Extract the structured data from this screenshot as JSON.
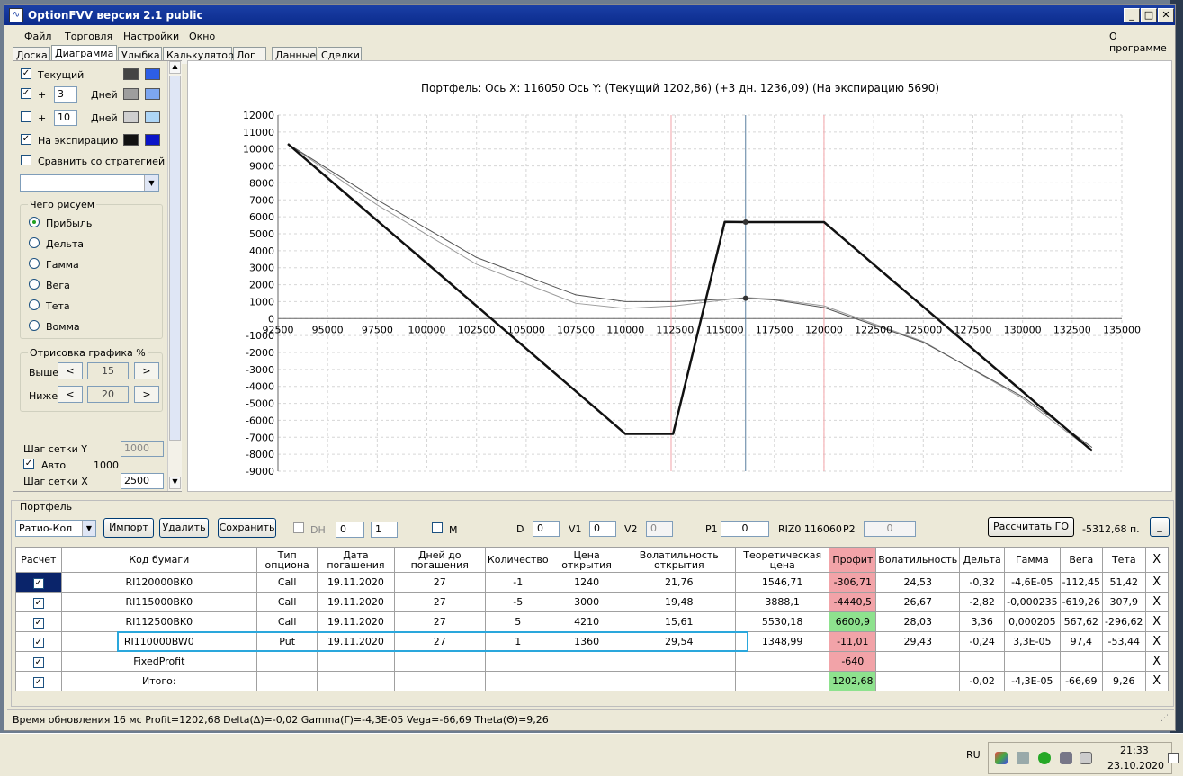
{
  "window": {
    "title": "OptionFVV версия 2.1 public"
  },
  "menu": {
    "items": [
      "Файл",
      "Торговля",
      "Настройки",
      "Окно"
    ],
    "about": "О программе"
  },
  "tabs": [
    "Доска",
    "Диаграмма",
    "Улыбка",
    "Калькулятор",
    "Лог",
    "Данные",
    "Сделки"
  ],
  "left": {
    "current_label": "Текущий",
    "plus": "+",
    "days_label": "Дней",
    "days1": "3",
    "days2": "10",
    "expiry_label": "На экспирацию",
    "compare_label": "Сравнить со стратегией",
    "draw_group": "Чего рисуем",
    "radios": [
      "Прибыль",
      "Дельта",
      "Гамма",
      "Вега",
      "Тета",
      "Вомма"
    ],
    "render_group": "Отрисовка графика %",
    "above_label": "Выше",
    "below_label": "Ниже",
    "above_val": "15",
    "below_val": "20",
    "grid_y_label": "Шаг сетки Y",
    "grid_y_val": "1000",
    "auto_label": "Авто",
    "auto_val": "1000",
    "grid_x_label": "Шаг сетки X",
    "grid_x_val": "2500",
    "arrow_left": "<",
    "arrow_right": ">",
    "colors": {
      "current": [
        "#444444",
        "#2d5ee6"
      ],
      "plus3": [
        "#9e9e9e",
        "#7da6f0"
      ],
      "plus10": [
        "#cfcfcf",
        "#aed6f6"
      ],
      "expiry": [
        "#111111",
        "#0a14c8"
      ]
    }
  },
  "chart_data": {
    "type": "line",
    "title": "Портфель: Ось X: 116050 Ось Y:  (Текущий 1202,86)  (+3 дн. 1236,09)  (На экспирацию 5690)",
    "xlim": [
      92500,
      135000
    ],
    "ylim": [
      -9000,
      12000
    ],
    "x_ticks": [
      92500,
      95000,
      97500,
      100000,
      102500,
      105000,
      107500,
      110000,
      112500,
      115000,
      117500,
      120000,
      122500,
      125000,
      127500,
      130000,
      132500,
      135000
    ],
    "y_ticks": [
      12000,
      11000,
      10000,
      9000,
      8000,
      7000,
      6000,
      5000,
      4000,
      3000,
      2000,
      1000,
      0,
      -1000,
      -2000,
      -3000,
      -4000,
      -5000,
      -6000,
      -7000,
      -8000,
      -9000
    ],
    "grid": true,
    "vlines": [
      {
        "x": 112300,
        "color": "#f2a3a8"
      },
      {
        "x": 116050,
        "color": "#5a7fa0"
      },
      {
        "x": 120000,
        "color": "#f2a3a8"
      }
    ],
    "series": [
      {
        "color": "#111111",
        "width": 2.5,
        "x": [
          93000,
          110000,
          112400,
          115000,
          116050,
          120000,
          133500
        ],
        "y": [
          10300,
          -6800,
          -6800,
          5700,
          5690,
          5690,
          -7800
        ]
      },
      {
        "color": "#555555",
        "width": 1,
        "x": [
          93000,
          97500,
          102500,
          107500,
          110000,
          112500,
          115000,
          116050,
          117500,
          120000,
          125000,
          130000,
          133500
        ],
        "y": [
          10300,
          7000,
          3600,
          1400,
          1000,
          1000,
          1150,
          1200,
          1100,
          650,
          -1400,
          -4600,
          -7600
        ]
      },
      {
        "color": "#9a9a9a",
        "width": 1,
        "x": [
          93000,
          97500,
          102500,
          107500,
          110000,
          112500,
          115000,
          116050,
          117500,
          120000,
          125000,
          130000,
          133500
        ],
        "y": [
          10300,
          6700,
          3200,
          900,
          600,
          750,
          1100,
          1240,
          1150,
          750,
          -1350,
          -4700,
          -7800
        ]
      }
    ],
    "markers": [
      {
        "x": 116050,
        "y": 5690
      },
      {
        "x": 116050,
        "y": 1203
      }
    ]
  },
  "portfolio": {
    "label": "Портфель",
    "mode": "Ратио-Кол",
    "import": "Импорт",
    "delete": "Удалить",
    "save": "Сохранить",
    "dh": "DH",
    "dh_val1": "0",
    "dh_val2": "1",
    "m": "M",
    "d_label": "D",
    "d_val": "0",
    "v1_label": "V1",
    "v1_val": "0",
    "v2_label": "V2",
    "v2_val": "0",
    "p1_label": "P1",
    "p1_val": "0",
    "riz": "RIZ0 116060",
    "p2_label": "P2",
    "p2_val": "0",
    "calc_go": "Рассчитать ГО",
    "go_value": "-5312,68 п.",
    "minimize": "_"
  },
  "table": {
    "headers": [
      "Расчет",
      "Код бумаги",
      "Тип опциона",
      "Дата погашения",
      "Дней до погашения",
      "Количество",
      "Цена открытия",
      "Волатильность открытия",
      "Теоретическая цена",
      "Профит",
      "Волатильность",
      "Дельта",
      "Гамма",
      "Вега",
      "Тета",
      "X"
    ],
    "rows": [
      [
        "",
        "RI120000BK0",
        "Call",
        "19.11.2020",
        "27",
        "-1",
        "1240",
        "21,76",
        "1546,71",
        "-306,71",
        "24,53",
        "-0,32",
        "-4,6E-05",
        "-112,45",
        "51,42",
        "X"
      ],
      [
        "",
        "RI115000BK0",
        "Call",
        "19.11.2020",
        "27",
        "-5",
        "3000",
        "19,48",
        "3888,1",
        "-4440,5",
        "26,67",
        "-2,82",
        "-0,000235",
        "-619,26",
        "307,9",
        "X"
      ],
      [
        "",
        "RI112500BK0",
        "Call",
        "19.11.2020",
        "27",
        "5",
        "4210",
        "15,61",
        "5530,18",
        "6600,9",
        "28,03",
        "3,36",
        "0,000205",
        "567,62",
        "-296,62",
        "X"
      ],
      [
        "",
        "RI110000BW0",
        "Put",
        "19.11.2020",
        "27",
        "1",
        "1360",
        "29,54",
        "1348,99",
        "-11,01",
        "29,43",
        "-0,24",
        "3,3E-05",
        "97,4",
        "-53,44",
        "X"
      ],
      [
        "",
        "FixedProfit",
        "",
        "",
        "",
        "",
        "",
        "",
        "",
        "-640",
        "",
        "",
        "",
        "",
        "",
        "X"
      ],
      [
        "",
        "Итого:",
        "",
        "",
        "",
        "",
        "",
        "",
        "",
        "1202,68",
        "",
        "-0,02",
        "-4,3E-05",
        "-66,69",
        "9,26",
        "X"
      ]
    ],
    "profit_sign": [
      "neg",
      "neg",
      "pos",
      "neg",
      "neg",
      "pos"
    ]
  },
  "status": "Время обновления 16 мс  Profit=1202,68 Delta(Δ)=-0,02 Gamma(Γ)=-4,3E-05 Vega=-66,69 Theta(Θ)=9,26",
  "taskbar": {
    "lang": "RU",
    "time": "21:33",
    "date": "23.10.2020"
  }
}
